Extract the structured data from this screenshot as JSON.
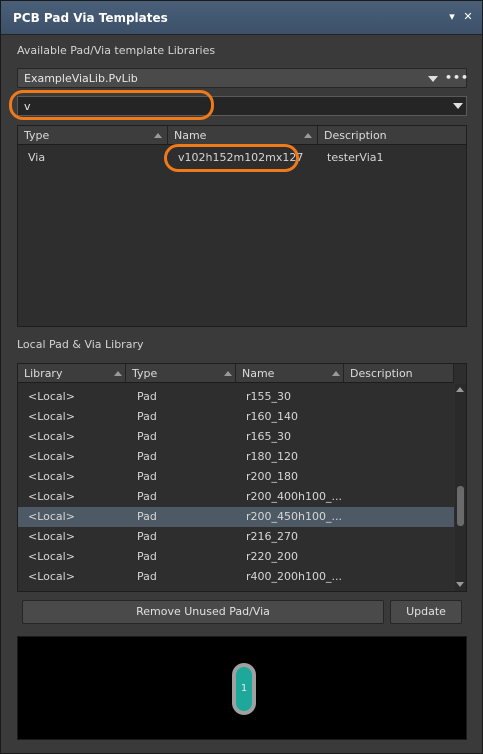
{
  "window": {
    "title": "PCB Pad Via Templates",
    "pin_glyph": "▾",
    "close_glyph": "✕"
  },
  "libraries": {
    "label": "Available Pad/Via template Libraries",
    "selected": "ExampleViaLib.PvLib",
    "more_glyph": "•••"
  },
  "filter": {
    "value": "v"
  },
  "template_grid": {
    "headers": [
      "Type",
      "Name",
      "Description"
    ],
    "rows": [
      {
        "type": "Via",
        "name": "v102h152m102mx127",
        "description": "testerVia1"
      }
    ]
  },
  "local_library": {
    "label": "Local Pad & Via Library",
    "headers": [
      "Library",
      "Type",
      "Name",
      "Description"
    ],
    "rows": [
      {
        "library": "<Local>",
        "type": "Pad",
        "name": "r155_30"
      },
      {
        "library": "<Local>",
        "type": "Pad",
        "name": "r160_140"
      },
      {
        "library": "<Local>",
        "type": "Pad",
        "name": "r165_30"
      },
      {
        "library": "<Local>",
        "type": "Pad",
        "name": "r180_120"
      },
      {
        "library": "<Local>",
        "type": "Pad",
        "name": "r200_180"
      },
      {
        "library": "<Local>",
        "type": "Pad",
        "name": "r200_400h100_..."
      },
      {
        "library": "<Local>",
        "type": "Pad",
        "name": "r200_450h100_..."
      },
      {
        "library": "<Local>",
        "type": "Pad",
        "name": "r216_270"
      },
      {
        "library": "<Local>",
        "type": "Pad",
        "name": "r220_200"
      },
      {
        "library": "<Local>",
        "type": "Pad",
        "name": "r400_200h100_..."
      }
    ],
    "selected_index": 6
  },
  "buttons": {
    "remove_unused": "Remove Unused Pad/Via",
    "update": "Update"
  },
  "preview": {
    "pad_label": "1"
  },
  "colors": {
    "accent_highlight": "#f07a1a",
    "pad_fill": "#1ea89c",
    "selection": "#4d5a66"
  }
}
